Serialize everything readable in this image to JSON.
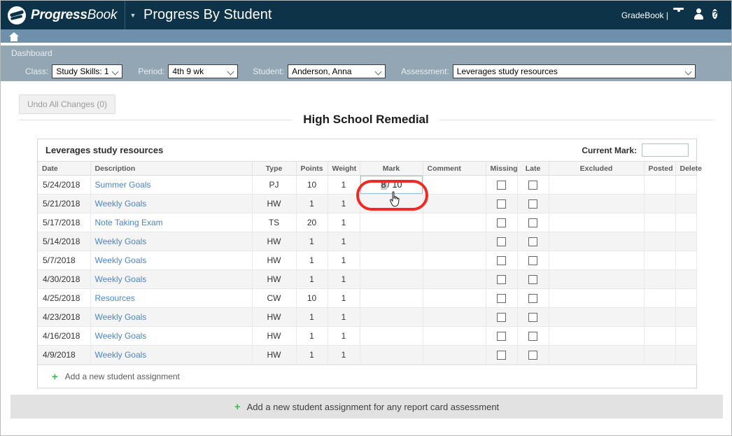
{
  "topbar": {
    "brand_progress": "Progress",
    "brand_book": "Book",
    "page_title": "Progress By Student",
    "account_label": "GradeBook |",
    "icons": [
      "bell-icon",
      "user-icon",
      "help-icon"
    ],
    "bg_color": "#0d3349"
  },
  "breadcrumb": {
    "label": "Dashboard"
  },
  "filters": {
    "class": {
      "label": "Class:",
      "value": "Study Skills: 1"
    },
    "period": {
      "label": "Period:",
      "value": "4th 9 wk"
    },
    "student": {
      "label": "Student:",
      "value": "Anderson, Anna"
    },
    "assessment": {
      "label": "Assessment:",
      "value": "Leverages study resources"
    }
  },
  "toolbar": {
    "undo_label": "Undo All Changes (0)"
  },
  "page_heading": "High School Remedial",
  "card": {
    "title": "Leverages study resources",
    "current_mark_label": "Current Mark:",
    "current_mark_value": ""
  },
  "table": {
    "columns": [
      "Date",
      "Description",
      "Type",
      "Points",
      "Weight",
      "Mark",
      "Comment",
      "Missing",
      "Late",
      "Excluded",
      "Posted",
      "Delete"
    ],
    "rows": [
      {
        "date": "5/24/2018",
        "description": "Summer Goals",
        "type": "PJ",
        "points": "10",
        "weight": "1",
        "mark": "8 / 10",
        "mark_selected": "8",
        "mark_rest": "/ 10",
        "comment": "",
        "excluded": "",
        "posted": "",
        "focused": true
      },
      {
        "date": "5/21/2018",
        "description": "Weekly Goals",
        "type": "HW",
        "points": "1",
        "weight": "1",
        "mark": "",
        "comment": "",
        "excluded": "",
        "posted": "",
        "focused": false
      },
      {
        "date": "5/17/2018",
        "description": "Note Taking Exam",
        "type": "TS",
        "points": "20",
        "weight": "1",
        "mark": "",
        "comment": "",
        "excluded": "",
        "posted": "",
        "focused": false
      },
      {
        "date": "5/14/2018",
        "description": "Weekly Goals",
        "type": "HW",
        "points": "1",
        "weight": "1",
        "mark": "",
        "comment": "",
        "excluded": "",
        "posted": "",
        "focused": false
      },
      {
        "date": "5/7/2018",
        "description": "Weekly Goals",
        "type": "HW",
        "points": "1",
        "weight": "1",
        "mark": "",
        "comment": "",
        "excluded": "",
        "posted": "",
        "focused": false
      },
      {
        "date": "4/30/2018",
        "description": "Weekly Goals",
        "type": "HW",
        "points": "1",
        "weight": "1",
        "mark": "",
        "comment": "",
        "excluded": "",
        "posted": "",
        "focused": false
      },
      {
        "date": "4/25/2018",
        "description": "Resources",
        "type": "CW",
        "points": "10",
        "weight": "1",
        "mark": "",
        "comment": "",
        "excluded": "",
        "posted": "",
        "focused": false
      },
      {
        "date": "4/23/2018",
        "description": "Weekly Goals",
        "type": "HW",
        "points": "1",
        "weight": "1",
        "mark": "",
        "comment": "",
        "excluded": "",
        "posted": "",
        "focused": false
      },
      {
        "date": "4/16/2018",
        "description": "Weekly Goals",
        "type": "HW",
        "points": "1",
        "weight": "1",
        "mark": "",
        "comment": "",
        "excluded": "",
        "posted": "",
        "focused": false
      },
      {
        "date": "4/9/2018",
        "description": "Weekly Goals",
        "type": "HW",
        "points": "1",
        "weight": "1",
        "mark": "",
        "comment": "",
        "excluded": "",
        "posted": "",
        "focused": false
      }
    ]
  },
  "add_assignment": {
    "label": "Add a new student assignment",
    "plus": "+"
  },
  "add_assignment_any": {
    "label": "Add a new student assignment for any report card assessment",
    "plus": "+"
  },
  "accent_colors": {
    "link": "#4b85c4",
    "plus_green": "#3cbd4e",
    "annotation_red": "#ee2a24"
  }
}
